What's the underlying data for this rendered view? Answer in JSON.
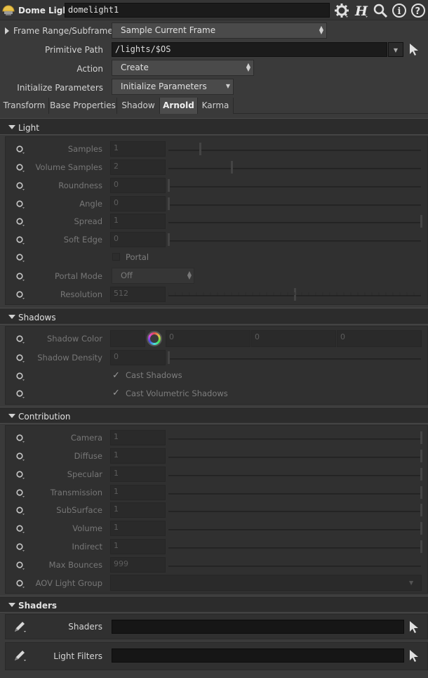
{
  "header": {
    "node_type": "Dome Light",
    "node_name": "domelight1",
    "icons": [
      "gear-icon",
      "houdini-help-icon",
      "search-icon",
      "info-icon",
      "help-icon"
    ]
  },
  "top_params": {
    "frame_range_label": "Frame Range/Subframes",
    "frame_range_value": "Sample Current Frame",
    "primitive_path_label": "Primitive Path",
    "primitive_path_value": "/lights/$OS",
    "action_label": "Action",
    "action_value": "Create",
    "init_label": "Initialize Parameters",
    "init_value": "Initialize Parameters"
  },
  "tabs": [
    "Transform",
    "Base Properties",
    "Shadow",
    "Arnold",
    "Karma"
  ],
  "active_tab": "Arnold",
  "light": {
    "title": "Light",
    "samples_label": "Samples",
    "samples_value": "1",
    "volume_samples_label": "Volume Samples",
    "volume_samples_value": "2",
    "roundness_label": "Roundness",
    "roundness_value": "0",
    "angle_label": "Angle",
    "angle_value": "0",
    "spread_label": "Spread",
    "spread_value": "1",
    "soft_edge_label": "Soft Edge",
    "soft_edge_value": "0",
    "portal_label": "Portal",
    "portal_mode_label": "Portal Mode",
    "portal_mode_value": "Off",
    "resolution_label": "Resolution",
    "resolution_value": "512"
  },
  "shadows": {
    "title": "Shadows",
    "shadow_color_label": "Shadow Color",
    "shadow_color_r": "0",
    "shadow_color_g": "0",
    "shadow_color_b": "0",
    "shadow_density_label": "Shadow Density",
    "shadow_density_value": "0",
    "cast_shadows_label": "Cast Shadows",
    "cast_volumetric_label": "Cast Volumetric Shadows"
  },
  "contribution": {
    "title": "Contribution",
    "camera_label": "Camera",
    "camera_value": "1",
    "diffuse_label": "Diffuse",
    "diffuse_value": "1",
    "specular_label": "Specular",
    "specular_value": "1",
    "transmission_label": "Transmission",
    "transmission_value": "1",
    "subsurface_label": "SubSurface",
    "subsurface_value": "1",
    "volume_label": "Volume",
    "volume_value": "1",
    "indirect_label": "Indirect",
    "indirect_value": "1",
    "max_bounces_label": "Max Bounces",
    "max_bounces_value": "999",
    "aov_label": "AOV Light Group",
    "aov_value": ""
  },
  "shaders": {
    "title": "Shaders",
    "shaders_label": "Shaders",
    "shaders_value": "",
    "light_filters_label": "Light Filters",
    "light_filters_value": ""
  },
  "colors": {
    "background": "#3a3a3a",
    "field_dark": "#1b1b1b",
    "disabled_text": "#777777"
  }
}
